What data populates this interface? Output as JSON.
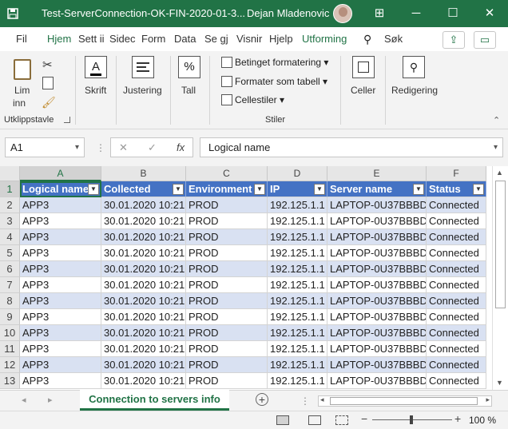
{
  "window": {
    "app_icon": "excel-save-icon",
    "filename": "Test-ServerConnection-OK-FIN-2020-01-3...",
    "user": "Dejan Mladenovic",
    "minimize": "─",
    "restore": "☐",
    "close": "✕",
    "ribbon_display_icon": "⊞"
  },
  "tabs": [
    "Fil",
    "Hjem",
    "Sett ii",
    "Sidec",
    "Form",
    "Data",
    "Se gj",
    "Visnir",
    "Hjelp",
    "Utforming"
  ],
  "tell_me": "Søk",
  "ribbon": {
    "clipboard": {
      "paste": "Lim",
      "paste2": "inn",
      "group": "Utklippstavle"
    },
    "font": {
      "label": "Skrift",
      "icon_letter": "A"
    },
    "alignment": {
      "label": "Justering"
    },
    "number": {
      "label": "Tall",
      "icon": "%"
    },
    "styles": {
      "conditional": "Betinget formatering",
      "as_table": "Formater som tabell",
      "cell_styles": "Cellestiler",
      "group": "Stiler"
    },
    "cells": {
      "label": "Celler"
    },
    "editing": {
      "label": "Redigering"
    }
  },
  "formula_bar": {
    "name_box": "A1",
    "cancel": "✕",
    "enter": "✓",
    "fx": "fx",
    "content": "Logical name"
  },
  "columns": [
    "A",
    "B",
    "C",
    "D",
    "E",
    "F"
  ],
  "header_row": [
    "Logical name",
    "Collected",
    "Environment",
    "IP",
    "Server name",
    "Status"
  ],
  "rows": [
    {
      "num": "1"
    },
    {
      "num": "2",
      "cells": [
        "APP3",
        "30.01.2020 10:21",
        "PROD",
        "192.125.1.1",
        "LAPTOP-0U37BBBD",
        "Connected"
      ]
    },
    {
      "num": "3",
      "cells": [
        "APP3",
        "30.01.2020 10:21",
        "PROD",
        "192.125.1.1",
        "LAPTOP-0U37BBBD",
        "Connected"
      ]
    },
    {
      "num": "4",
      "cells": [
        "APP3",
        "30.01.2020 10:21",
        "PROD",
        "192.125.1.1",
        "LAPTOP-0U37BBBD",
        "Connected"
      ]
    },
    {
      "num": "5",
      "cells": [
        "APP3",
        "30.01.2020 10:21",
        "PROD",
        "192.125.1.1",
        "LAPTOP-0U37BBBD",
        "Connected"
      ]
    },
    {
      "num": "6",
      "cells": [
        "APP3",
        "30.01.2020 10:21",
        "PROD",
        "192.125.1.1",
        "LAPTOP-0U37BBBD",
        "Connected"
      ]
    },
    {
      "num": "7",
      "cells": [
        "APP3",
        "30.01.2020 10:21",
        "PROD",
        "192.125.1.1",
        "LAPTOP-0U37BBBD",
        "Connected"
      ]
    },
    {
      "num": "8",
      "cells": [
        "APP3",
        "30.01.2020 10:21",
        "PROD",
        "192.125.1.1",
        "LAPTOP-0U37BBBD",
        "Connected"
      ]
    },
    {
      "num": "9",
      "cells": [
        "APP3",
        "30.01.2020 10:21",
        "PROD",
        "192.125.1.1",
        "LAPTOP-0U37BBBD",
        "Connected"
      ]
    },
    {
      "num": "10",
      "cells": [
        "APP3",
        "30.01.2020 10:21",
        "PROD",
        "192.125.1.1",
        "LAPTOP-0U37BBBD",
        "Connected"
      ]
    },
    {
      "num": "11",
      "cells": [
        "APP3",
        "30.01.2020 10:21",
        "PROD",
        "192.125.1.1",
        "LAPTOP-0U37BBBD",
        "Connected"
      ]
    },
    {
      "num": "12",
      "cells": [
        "APP3",
        "30.01.2020 10:21",
        "PROD",
        "192.125.1.1",
        "LAPTOP-0U37BBBD",
        "Connected"
      ]
    },
    {
      "num": "13",
      "cells": [
        "APP3",
        "30.01.2020 10:21",
        "PROD",
        "192.125.1.1",
        "LAPTOP-0U37BBBD",
        "Connected"
      ]
    }
  ],
  "sheet_tab": "Connection to servers info",
  "zoom": "100 %",
  "colors": {
    "brand": "#217346",
    "table_header": "#4472c4",
    "band": "#d9e1f2"
  }
}
